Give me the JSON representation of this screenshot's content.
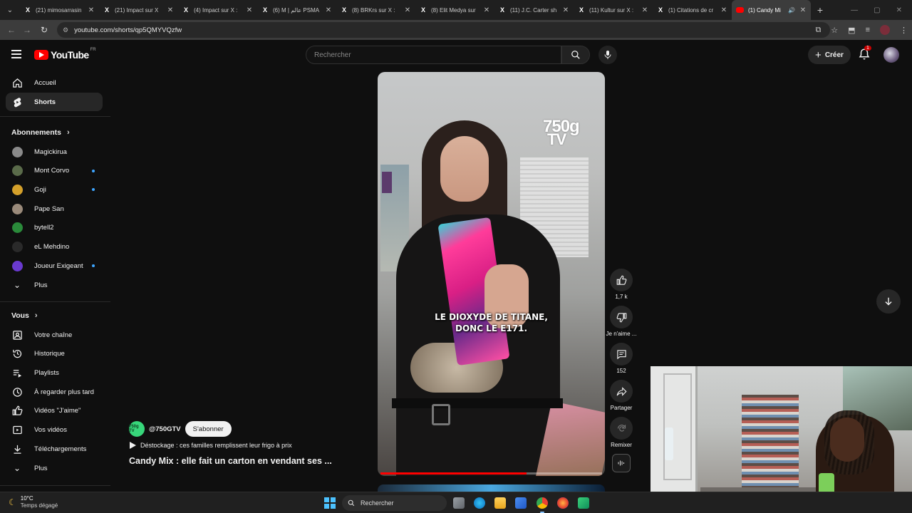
{
  "browser": {
    "tabs": [
      {
        "favicon": "x-logo",
        "title": "(21) mimosarrasin",
        "active": false
      },
      {
        "favicon": "x-logo",
        "title": "(21) Impact sur X",
        "active": false
      },
      {
        "favicon": "x-logo",
        "title": "(4) Impact sur X :",
        "active": false
      },
      {
        "favicon": "x-logo",
        "title": "(6) M | عالم PSMA",
        "active": false
      },
      {
        "favicon": "x-logo",
        "title": "(8) BRKrs sur X :",
        "active": false
      },
      {
        "favicon": "x-logo",
        "title": "(8) Elit Medya sur",
        "active": false
      },
      {
        "favicon": "x-logo",
        "title": "(11) J.C. Carter sh",
        "active": false
      },
      {
        "favicon": "x-logo",
        "title": "(11) Kultur sur X :",
        "active": false
      },
      {
        "favicon": "x-logo",
        "title": "(1) Citations de cr",
        "active": false
      },
      {
        "favicon": "youtube-logo",
        "title": "(1) Candy Mi",
        "active": true
      }
    ],
    "url": "youtube.com/shorts/qp5QMYVQzfw"
  },
  "youtube": {
    "logo_text": "YouTube",
    "country_code": "FR",
    "search_placeholder": "Rechercher",
    "create_label": "Créer",
    "notification_count": "1"
  },
  "sidebar": {
    "main": [
      {
        "icon": "home-icon",
        "label": "Accueil",
        "active": false
      },
      {
        "icon": "shorts-icon",
        "label": "Shorts",
        "active": true
      }
    ],
    "subscriptions_title": "Abonnements",
    "subscriptions": [
      {
        "label": "Magickirua",
        "new": false,
        "color": "#8a8a8a"
      },
      {
        "label": "Mont Corvo",
        "new": true,
        "color": "#5a6b4a"
      },
      {
        "label": "Goji",
        "new": true,
        "color": "#d4a02a"
      },
      {
        "label": "Pape San",
        "new": false,
        "color": "#9a8a7a"
      },
      {
        "label": "bytell2",
        "new": false,
        "color": "#2a8a3a"
      },
      {
        "label": "eL Mehdino",
        "new": false,
        "color": "#2a2a2a"
      },
      {
        "label": "Joueur Exigeant",
        "new": true,
        "color": "#6a3ad0"
      }
    ],
    "subscriptions_more": "Plus",
    "you_title": "Vous",
    "you": [
      {
        "icon": "channel-icon",
        "label": "Votre chaîne"
      },
      {
        "icon": "history-icon",
        "label": "Historique"
      },
      {
        "icon": "playlists-icon",
        "label": "Playlists"
      },
      {
        "icon": "watch-later-icon",
        "label": "À regarder plus tard"
      },
      {
        "icon": "liked-videos-icon",
        "label": "Vidéos \"J'aime\""
      },
      {
        "icon": "your-videos-icon",
        "label": "Vos vidéos"
      },
      {
        "icon": "downloads-icon",
        "label": "Téléchargements"
      }
    ],
    "you_more": "Plus"
  },
  "short": {
    "watermark_line1": "750g",
    "watermark_line2": "TV",
    "caption_line1": "LE DIOXYDE DE TITANE,",
    "caption_line2": "DONC LE E171.",
    "progress": 0.66,
    "actions": {
      "like_count": "1,7 k",
      "dislike_label": "Je n'aime ...",
      "comments_count": "152",
      "share_label": "Partager",
      "remix_label": "Remixer"
    },
    "channel_avatar_text": "750g TV",
    "channel_handle": "@750GTV",
    "subscribe_label": "S'abonner",
    "sound_title": "Déstockage : ces familles remplissent leur frigo à prix",
    "title": "Candy Mix : elle fait un carton en vendant ses ..."
  },
  "taskbar": {
    "temperature": "10°C",
    "weather": "Temps dégagé",
    "search_label": "Rechercher"
  },
  "colors": {
    "accent_red": "#ff0000",
    "new_dot": "#3ea6ff",
    "background": "#0f0f0f"
  }
}
